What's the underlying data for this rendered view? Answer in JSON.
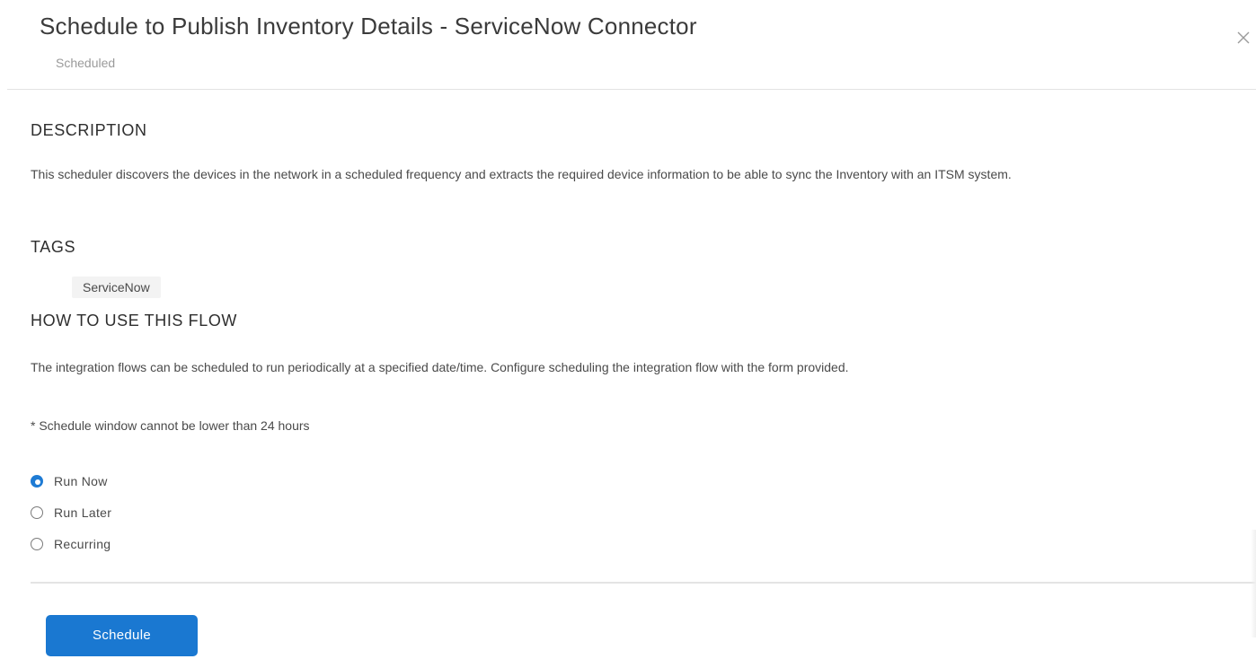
{
  "header": {
    "title": "Schedule to Publish Inventory Details - ServiceNow Connector",
    "status": "Scheduled",
    "close_icon": "close-icon"
  },
  "description": {
    "heading": "DESCRIPTION",
    "text": "This scheduler discovers the devices in the network in a scheduled frequency and extracts the required device information to be able to sync the Inventory with an ITSM system."
  },
  "tags": {
    "heading": "TAGS",
    "items": [
      "ServiceNow"
    ]
  },
  "how_to": {
    "heading": "HOW TO USE THIS FLOW",
    "text": "The integration flows can be scheduled to run periodically at a specified date/time. Configure scheduling the integration flow with the form provided.",
    "note": "* Schedule window cannot be lower than 24 hours"
  },
  "schedule_options": {
    "selected": "Run Now",
    "options": [
      {
        "label": "Run Now",
        "checked": true
      },
      {
        "label": "Run Later",
        "checked": false
      },
      {
        "label": "Recurring",
        "checked": false
      }
    ]
  },
  "footer": {
    "schedule_label": "Schedule"
  },
  "colors": {
    "accent": "#1a78d1",
    "text": "#4a4a4a",
    "muted": "#9a9a9a"
  }
}
